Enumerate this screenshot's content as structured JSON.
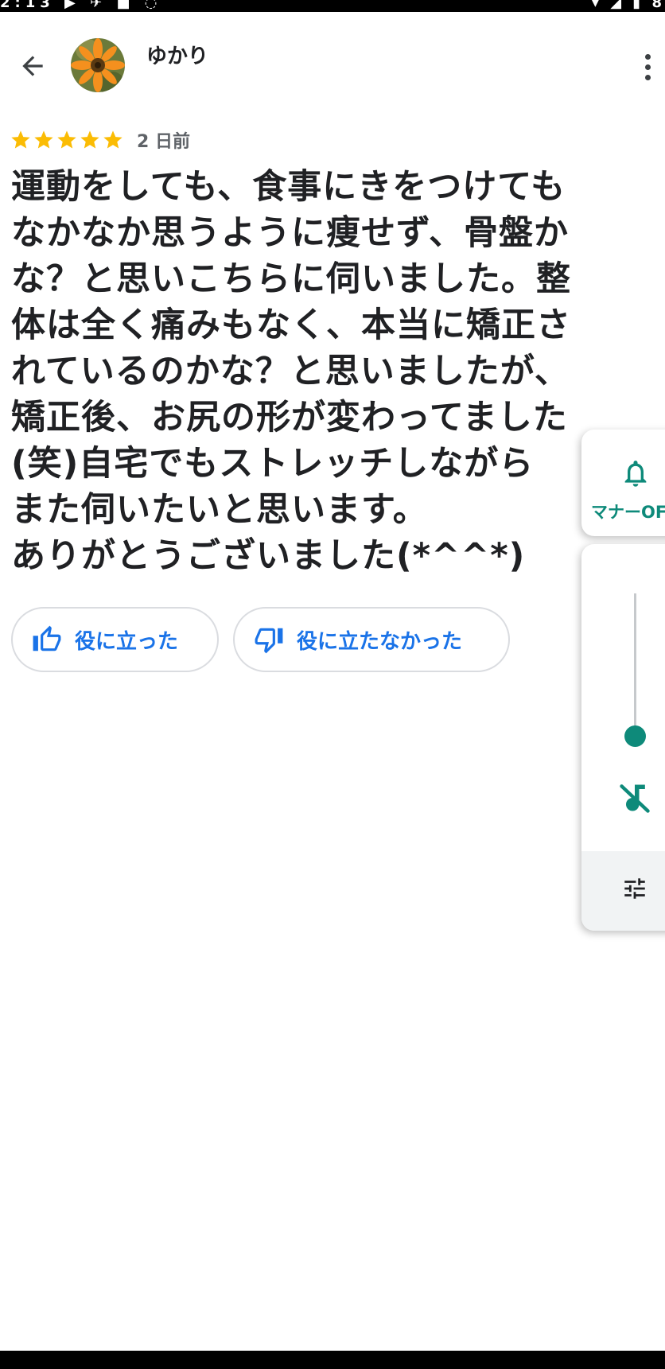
{
  "status_bar": {
    "left_glyphs": "2:13 ▶ ✈ ■ ◌",
    "right_glyphs": "▾ ◢ ▮ 8"
  },
  "header": {
    "back_icon": "arrow-back-icon",
    "avatar_icon": "orange-flower-avatar",
    "reviewer_name": "ゆかり",
    "more_icon": "more-vert-icon"
  },
  "rating": {
    "stars": 5,
    "max_stars": 5,
    "star_color": "#fbbc04",
    "date": "2 日前"
  },
  "review": {
    "lines": [
      "運動をしても、食事にきをつけても",
      "なかなか思うように痩せず、骨盤か",
      "な？と思いこちらに伺いました。整",
      "体は全く痛みもなく、本当に矯正さ",
      "れているのかな？と思いましたが、",
      "矯正後、お尻の形が変わってました",
      "(笑)自宅でもストレッチしながら",
      "また伺いたいと思います。",
      "ありがとうございました(*^^*)"
    ]
  },
  "actions": {
    "helpful_label": "役に立った",
    "not_helpful_label": "役に立たなかった",
    "accent_color": "#1a73e8"
  },
  "volume_panel": {
    "mode_label": "マナーOFF",
    "accent_color": "#0e8a7a",
    "level": 0.0,
    "icons": [
      "bell-icon",
      "music-off-icon",
      "tune-icon"
    ]
  }
}
